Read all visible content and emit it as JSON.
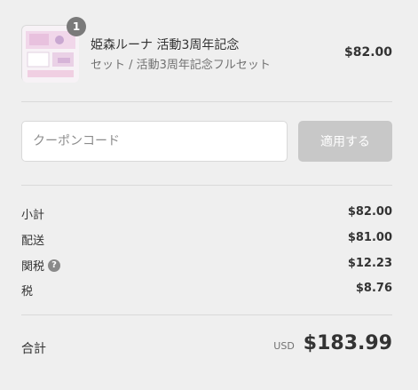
{
  "product": {
    "quantity": "1",
    "title": "姫森ルーナ 活動3周年記念",
    "variant": "セット / 活動3周年記念フルセット",
    "price": "$82.00"
  },
  "coupon": {
    "placeholder": "クーポンコード",
    "apply_label": "適用する"
  },
  "summary": {
    "lines": [
      {
        "label": "小計",
        "value": "$82.00"
      },
      {
        "label": "配送",
        "value": "$81.00"
      },
      {
        "label": "関税",
        "value": "$12.23",
        "help_icon": "question-icon"
      },
      {
        "label": "税",
        "value": "$8.76"
      }
    ],
    "total_label": "合計",
    "currency": "USD",
    "total_value": "$183.99"
  },
  "colors": {
    "background": "#efefef",
    "badge": "#7a7a7a",
    "button_disabled": "#c8c8c8"
  }
}
